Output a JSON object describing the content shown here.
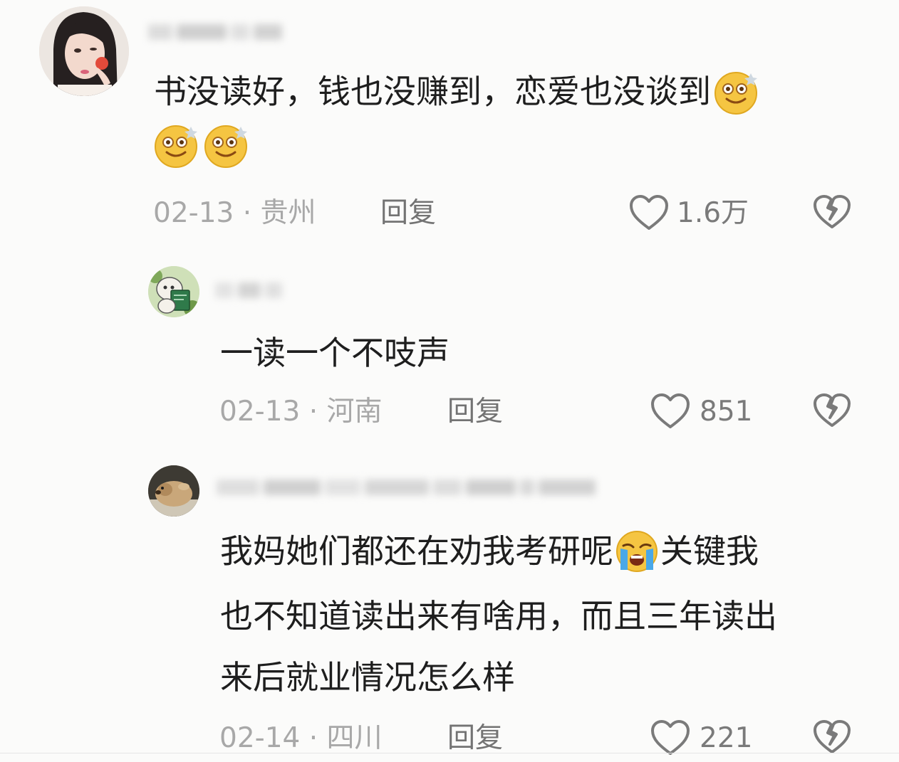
{
  "comments": [
    {
      "text_line1": "书没读好，钱也没赚到，恋爱也没谈到",
      "date": "02-13",
      "separator": "·",
      "location": "贵州",
      "reply_label": "回复",
      "likes": "1.6万"
    },
    {
      "text_line1": "一读一个不吱声",
      "date": "02-13",
      "separator": "·",
      "location": "河南",
      "reply_label": "回复",
      "likes": "851"
    },
    {
      "text_line1_a": "我妈她们都还在劝我考研呢",
      "text_line1_b": "关键我",
      "text_line2": "也不知道读出来有啥用，而且三年读出",
      "text_line3": "来后就业情况怎么样",
      "date": "02-14",
      "separator": "·",
      "location": "四川",
      "reply_label": "回复",
      "likes": "221"
    }
  ],
  "icons": {
    "like": "heart-outline-icon",
    "dislike": "broken-heart-icon",
    "emoji_1": "dizzy-smile-emoji",
    "emoji_2": "loudly-crying-emoji"
  },
  "colors": {
    "text": "#1e1e1e",
    "meta": "#a8a8a8",
    "reply": "#737373",
    "icon": "#7a7a7a"
  }
}
